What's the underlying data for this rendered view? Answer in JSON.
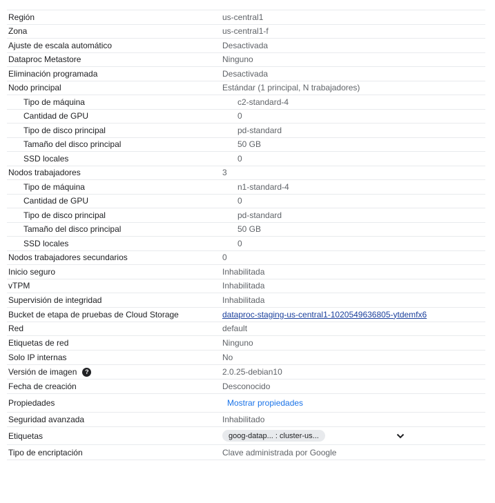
{
  "rows": [
    {
      "label": "Región",
      "value": "us-central1"
    },
    {
      "label": "Zona",
      "value": "us-central1-f"
    },
    {
      "label": "Ajuste de escala automático",
      "value": "Desactivada"
    },
    {
      "label": "Dataproc Metastore",
      "value": "Ninguno"
    },
    {
      "label": "Eliminación programada",
      "value": "Desactivada"
    },
    {
      "label": "Nodo principal",
      "value": "Estándar (1 principal, N trabajadores)"
    },
    {
      "label": "Tipo de máquina",
      "value": "c2-standard-4"
    },
    {
      "label": "Cantidad de GPU",
      "value": "0"
    },
    {
      "label": "Tipo de disco principal",
      "value": "pd-standard"
    },
    {
      "label": "Tamaño del disco principal",
      "value": "50 GB"
    },
    {
      "label": "SSD locales",
      "value": "0"
    },
    {
      "label": "Nodos trabajadores",
      "value": "3"
    },
    {
      "label": "Tipo de máquina",
      "value": "n1-standard-4"
    },
    {
      "label": "Cantidad de GPU",
      "value": "0"
    },
    {
      "label": "Tipo de disco principal",
      "value": "pd-standard"
    },
    {
      "label": "Tamaño del disco principal",
      "value": "50 GB"
    },
    {
      "label": "SSD locales",
      "value": "0"
    },
    {
      "label": "Nodos trabajadores secundarios",
      "value": "0"
    },
    {
      "label": "Inicio seguro",
      "value": "Inhabilitada"
    },
    {
      "label": "vTPM",
      "value": "Inhabilitada"
    },
    {
      "label": "Supervisión de integridad",
      "value": "Inhabilitada"
    },
    {
      "label": "Bucket de etapa de pruebas de Cloud Storage",
      "value": "dataproc-staging-us-central1-1020549636805-ytdemfx6"
    },
    {
      "label": "Red",
      "value": "default"
    },
    {
      "label": "Etiquetas de red",
      "value": "Ninguno"
    },
    {
      "label": "Solo IP internas",
      "value": "No"
    },
    {
      "label": "Versión de imagen",
      "value": "2.0.25-debian10",
      "help_icon": "question-circle-icon"
    },
    {
      "label": "Fecha de creación",
      "value": "Desconocido"
    },
    {
      "label": "Propiedades",
      "value": "Mostrar propiedades"
    },
    {
      "label": "Seguridad avanzada",
      "value": "Inhabilitado"
    },
    {
      "label": "Etiquetas",
      "value": "goog-datap... : cluster-us...",
      "expand_icon": "chevron-down-icon"
    },
    {
      "label": "Tipo de encriptación",
      "value": "Clave administrada por Google"
    }
  ],
  "help_glyph": "?"
}
